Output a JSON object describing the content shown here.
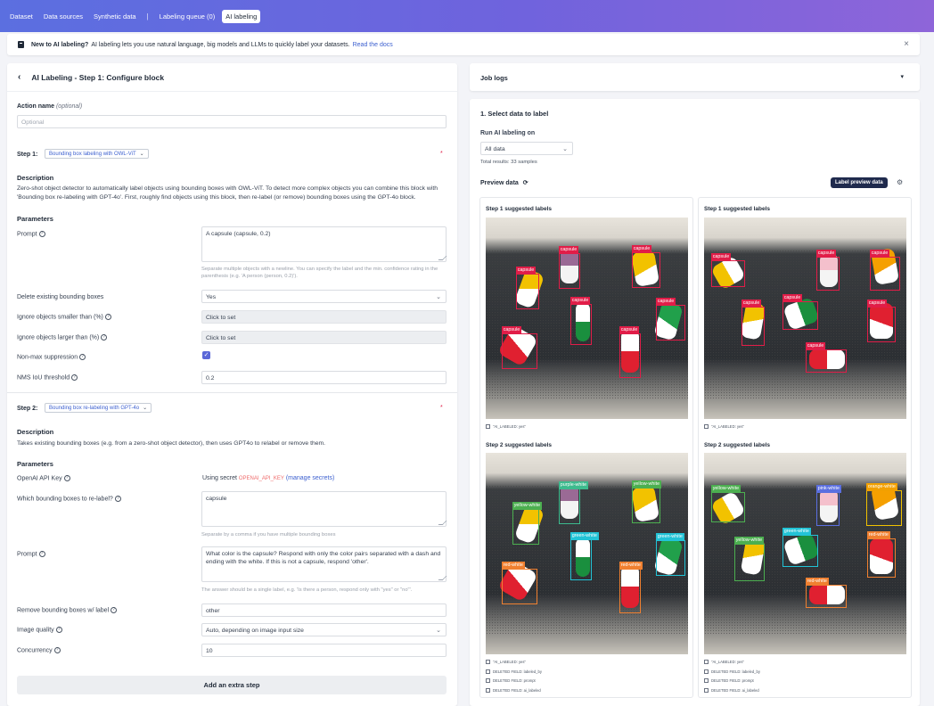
{
  "nav": {
    "items": [
      {
        "label": "Dataset"
      },
      {
        "label": "Data sources"
      },
      {
        "label": "Synthetic data"
      },
      {
        "label": "Labeling queue (0)"
      },
      {
        "label": "AI labeling"
      }
    ],
    "active": "AI labeling"
  },
  "banner": {
    "bold": "New to AI labeling?",
    "text": "AI labeling lets you use natural language, big models and LLMs to quickly label your datasets.",
    "link": "Read the docs",
    "close": "×"
  },
  "left": {
    "title": "AI Labeling - Step 1: Configure block",
    "action_name_label": "Action name",
    "action_name_optional": "(optional)",
    "action_name_placeholder": "Optional",
    "step1": {
      "label": "Step 1:",
      "block": "Bounding box labeling with OWL-ViT",
      "description_title": "Description",
      "description": "Zero-shot object detector to automatically label objects using bounding boxes with OWL-ViT. To detect more complex objects you can combine this block with 'Bounding box re-labeling with GPT-4o'. First, roughly find objects using this block, then re-label (or remove) bounding boxes using the GPT-4o block.",
      "parameters_title": "Parameters",
      "prompt_label": "Prompt",
      "prompt_value": "A capsule (capsule, 0.2)",
      "prompt_help": "Separate multiple objects with a newline. You can specify the label and the min. confidence rating in the parenthesis (e.g. 'A person (person, 0.2)').",
      "delete_label": "Delete existing bounding boxes",
      "delete_value": "Yes",
      "smaller_label": "Ignore objects smaller than (%)",
      "smaller_value": "Click to set",
      "larger_label": "Ignore objects larger than (%)",
      "larger_value": "Click to set",
      "nms_label": "Non-max suppression",
      "nms_iou_label": "NMS IoU threshold",
      "nms_iou_value": "0.2"
    },
    "step2": {
      "label": "Step 2:",
      "block": "Bounding box re-labeling with GPT-4o",
      "description_title": "Description",
      "description": "Takes existing bounding boxes (e.g. from a zero-shot object detector), then uses GPT4o to relabel or remove them.",
      "parameters_title": "Parameters",
      "apikey_label": "OpenAI API Key",
      "apikey_prefix": "Using secret",
      "apikey_secret": "OPENAI_API_KEY",
      "apikey_manage": "(manage secrets)",
      "which_label": "Which bounding boxes to re-label?",
      "which_value": "capsule",
      "which_help": "Separate by a comma if you have multiple bounding boxes",
      "prompt_label": "Prompt",
      "prompt_value": "What color is the capsule? Respond with only the color pairs separated with a dash and ending with the white. If this is not a capsule, respond 'other'.",
      "prompt_help": "The answer should be a single label, e.g. 'Is there a person, respond only with \"yes\" or \"no\"'.",
      "remove_label": "Remove bounding boxes w/ label",
      "remove_value": "other",
      "quality_label": "Image quality",
      "quality_value": "Auto, depending on image input size",
      "concurrency_label": "Concurrency",
      "concurrency_value": "10"
    },
    "add_step": "Add an extra step",
    "required": "*"
  },
  "right": {
    "job_logs": "Job logs",
    "select_title": "1. Select data to label",
    "run_on_label": "Run AI labeling on",
    "run_on_value": "All data",
    "total": "Total results: 33 samples",
    "preview_label": "Preview data",
    "preview_button": "Label preview data",
    "cards": [
      {
        "step1": "Step 1 suggested labels",
        "meta1": [
          "\"AI_LABELED: yes\""
        ],
        "step2": "Step 2 suggested labels",
        "meta2": [
          "\"AI_LABELED: yes\"",
          "DELETED FIELD: labeled_by",
          "DELETED FIELD: prompt",
          "DELETED FIELD: ai_labeled"
        ]
      },
      {
        "step1": "Step 1 suggested labels",
        "meta1": [
          "\"AI_LABELED: yes\""
        ],
        "step2": "Step 2 suggested labels",
        "meta2": [
          "\"AI_LABELED: yes\"",
          "DELETED FIELD: labeled_by",
          "DELETED FIELD: prompt",
          "DELETED FIELD: ai_labeled"
        ]
      }
    ],
    "boxes": {
      "a1": [
        "capsule",
        "capsule",
        "capsule",
        "capsule",
        "capsule",
        "capsule",
        "capsule"
      ],
      "a2": [
        "purple-white",
        "yellow-white",
        "yellow-white",
        "green-white",
        "green-white",
        "red-white",
        "red-white"
      ],
      "b1": [
        "capsule",
        "capsule",
        "capsule",
        "capsule",
        "capsule",
        "capsule",
        "capsule"
      ],
      "b2": [
        "yellow-white",
        "pink-white",
        "orange-white",
        "yellow-white",
        "green-white",
        "red-white",
        "red-white"
      ]
    }
  },
  "colors": {
    "accent": "#5a67d8",
    "capsule_box": "#e11d48",
    "brand_gradient": [
      "#5b6fe0",
      "#8e65d9"
    ]
  }
}
